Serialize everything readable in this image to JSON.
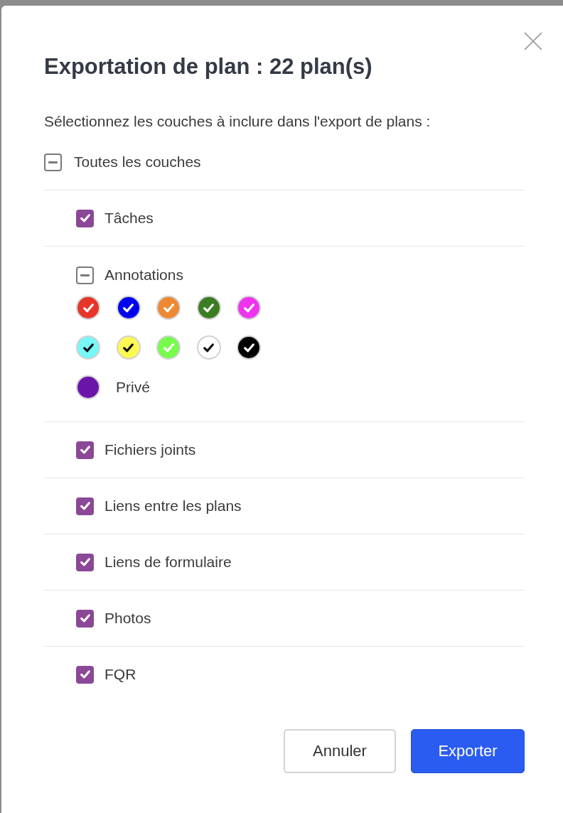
{
  "dialog": {
    "title": "Exportation de plan : 22 plan(s)",
    "instruction": "Sélectionnez les couches à inclure dans l'export de plans :"
  },
  "all_layers": {
    "label": "Toutes les couches",
    "checked": false,
    "indeterminate": true
  },
  "layers": [
    {
      "kind": "checkbox",
      "label": "Tâches",
      "checked": true,
      "indeterminate": false
    },
    {
      "kind": "group",
      "label": "Annotations",
      "checked": false,
      "indeterminate": true,
      "colors": [
        {
          "color": "#e8352a",
          "checked": true
        },
        {
          "color": "#0000f0",
          "checked": true
        },
        {
          "color": "#ee8833",
          "checked": true
        },
        {
          "color": "#3a7d23",
          "checked": true
        },
        {
          "color": "#ee33ee",
          "checked": true
        },
        {
          "color": "#77f7f8",
          "checked": true
        },
        {
          "color": "#fdf954",
          "checked": true
        },
        {
          "color": "#77fc4c",
          "checked": true
        },
        {
          "color": "#ffffff",
          "checked": true
        },
        {
          "color": "#000000",
          "checked": true
        }
      ],
      "private": {
        "label": "Privé",
        "color": "#6b14a9",
        "checked": false
      }
    },
    {
      "kind": "checkbox",
      "label": "Fichiers joints",
      "checked": true,
      "indeterminate": false
    },
    {
      "kind": "checkbox",
      "label": "Liens entre les plans",
      "checked": true,
      "indeterminate": false
    },
    {
      "kind": "checkbox",
      "label": "Liens de formulaire",
      "checked": true,
      "indeterminate": false
    },
    {
      "kind": "checkbox",
      "label": "Photos",
      "checked": true,
      "indeterminate": false
    },
    {
      "kind": "checkbox",
      "label": "FQR",
      "checked": true,
      "indeterminate": false
    }
  ],
  "buttons": [
    {
      "label": "Annuler",
      "kind": "secondary"
    },
    {
      "label": "Exporter",
      "kind": "primary"
    }
  ]
}
